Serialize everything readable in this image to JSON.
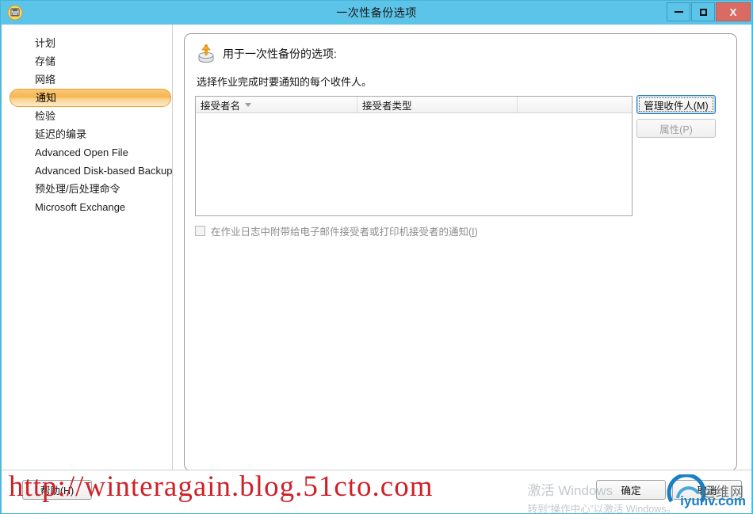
{
  "window": {
    "title": "一次性备份选项",
    "icon": "backup-disk-icon",
    "titlebar_color": "#5bc4e8",
    "close_color": "#d96b63",
    "caption": {
      "minimize_label": "最小化",
      "maximize_label": "最大化",
      "close_label": "X"
    }
  },
  "sidebar": {
    "items": [
      {
        "label": "计划",
        "selected": false
      },
      {
        "label": "存储",
        "selected": false
      },
      {
        "label": "网络",
        "selected": false
      },
      {
        "label": "通知",
        "selected": true
      },
      {
        "label": "检验",
        "selected": false
      },
      {
        "label": "延迟的编录",
        "selected": false
      },
      {
        "label": "Advanced Open File",
        "selected": false
      },
      {
        "label": "Advanced Disk-based Backup",
        "selected": false
      },
      {
        "label": "预处理/后处理命令",
        "selected": false
      },
      {
        "label": "Microsoft Exchange",
        "selected": false
      }
    ],
    "selected_accent": "#f6b64e"
  },
  "panel": {
    "header_icon": "backup-options-icon",
    "header": "用于一次性备份的选项:",
    "subtitle": "选择作业完成时要通知的每个收件人。",
    "listview": {
      "columns": [
        {
          "label": "接受者名",
          "sorted": true,
          "sort_icon": "sort-descending-arrow"
        },
        {
          "label": "接受者类型",
          "sorted": false
        },
        {
          "label": "",
          "sorted": false
        }
      ],
      "rows": []
    },
    "buttons": [
      {
        "label": "管理收件人(M)",
        "mnemonic": "M",
        "state": "focused"
      },
      {
        "label": "属性(P)",
        "mnemonic": "P",
        "state": "disabled"
      }
    ],
    "checkbox": {
      "checked": false,
      "enabled": false,
      "label_before": "在作业日志中附带给电子邮件接受者或打印机接受者的通知(",
      "mnemonic": "I",
      "label_after": ")"
    }
  },
  "footer": {
    "help_label": "帮助(H)",
    "ok_label": "确定",
    "cancel_label": "取消"
  },
  "watermarks": {
    "url": "http://winteragain.blog.51cto.com",
    "url_color": "#cf2128",
    "activation_line1": "激活 Windows",
    "activation_line2": "转到“操作中心”以激活 Windows。",
    "logo_cn": "运维网",
    "logo_en": "iyunv.com",
    "logo_color": "#1b7fc4"
  }
}
